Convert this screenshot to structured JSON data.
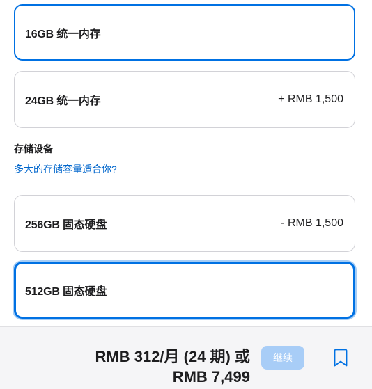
{
  "memory": {
    "options": [
      {
        "label": "16GB 统一内存",
        "price": ""
      },
      {
        "label": "24GB 统一内存",
        "price": "+ RMB 1,500"
      }
    ]
  },
  "storage": {
    "title": "存储设备",
    "help_link": "多大的存储容量适合你?",
    "options": [
      {
        "label": "256GB 固态硬盘",
        "price": "- RMB 1,500"
      },
      {
        "label": "512GB 固态硬盘",
        "price": ""
      }
    ]
  },
  "footer": {
    "monthly": "RMB 312/月 (24 期) 或",
    "total": "RMB 7,499",
    "continue_label": "继续",
    "bookmark_icon": "bookmark-icon"
  },
  "colors": {
    "accent": "#0071e3",
    "link": "#0066cc",
    "button_disabled": "#a8cdf7",
    "footer_bg": "#f5f5f7"
  }
}
